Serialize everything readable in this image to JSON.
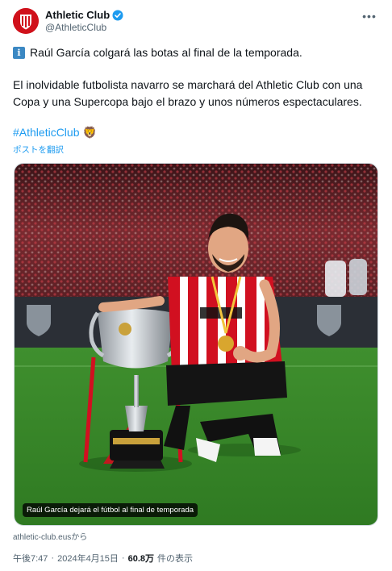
{
  "account": {
    "display_name": "Athletic Club",
    "handle": "@AthleticClub",
    "verified": true,
    "avatar_icon": "athletic-club-crest-icon",
    "more_icon": "more-options-icon"
  },
  "tweet": {
    "info_icon": "info-icon",
    "line1": "Raúl García colgará las botas al final de la temporada.",
    "paragraph2": "El inolvidable futbolista navarro se marchará del Athletic Club con una Copa y una Supercopa bajo el brazo y unos números espectaculares.",
    "hashtag": "#AthleticClub",
    "hashtag_emoji": "🦁",
    "translate_label": "ポストを翻訳"
  },
  "media": {
    "caption": "Raúl García dejará el fútbol al final de temporada",
    "link_source": "athletic-club.eusから"
  },
  "meta": {
    "time": "午後7:47",
    "separator": "·",
    "date": "2024年4月15日",
    "views_count": "60.8万",
    "views_label": "件の表示"
  },
  "colors": {
    "brand_red": "#d0111b",
    "link_blue": "#1d9bf0",
    "muted_text": "#536471"
  }
}
